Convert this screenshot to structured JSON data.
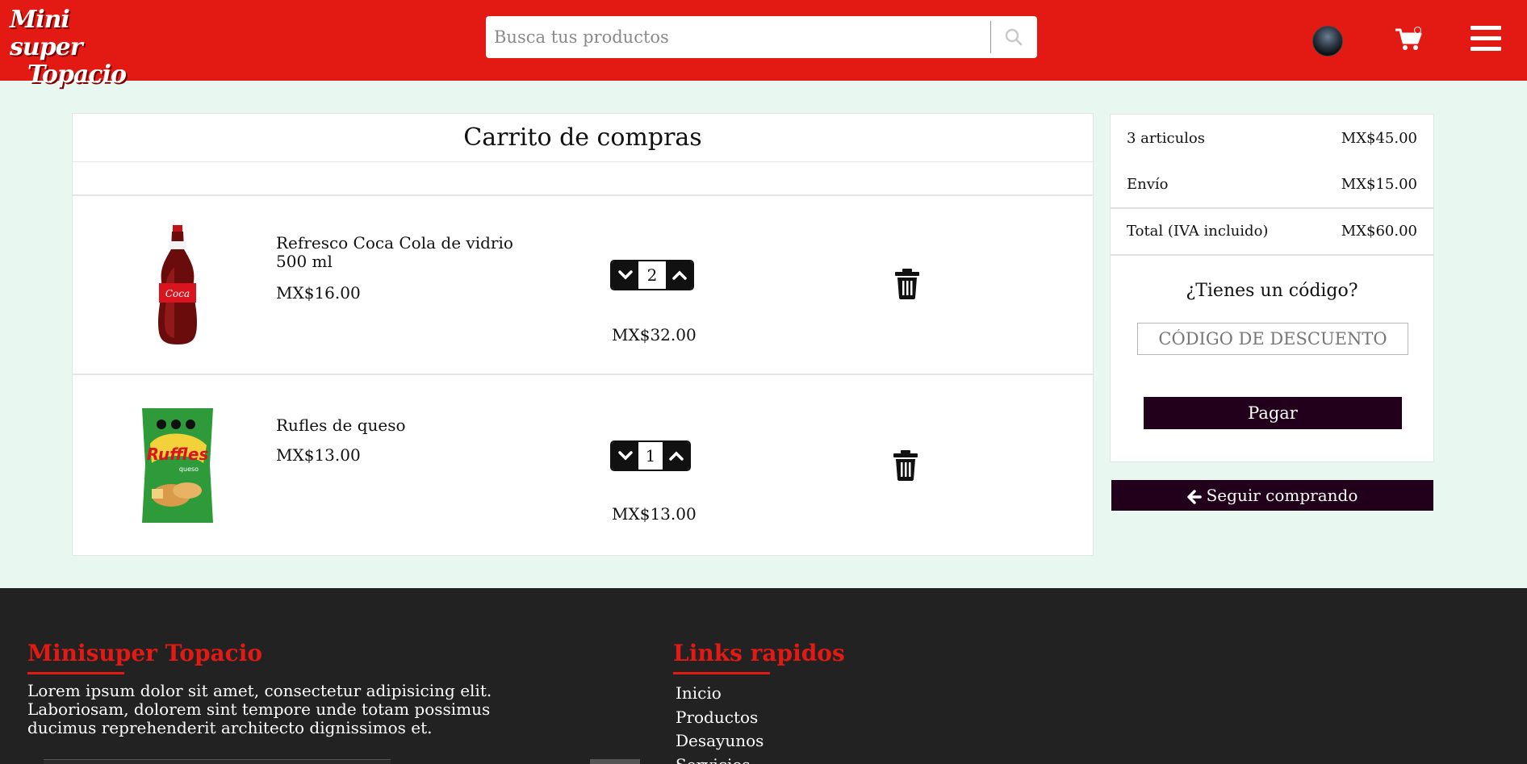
{
  "header": {
    "logo_line1": "Mini super",
    "logo_line2": "Topacio",
    "search_placeholder": "Busca tus productos",
    "cart_badge": "",
    "brand_color": "#e31a14"
  },
  "cart": {
    "title": "Carrito de compras",
    "items": [
      {
        "name": "Refresco Coca Cola de vidrio 500 ml",
        "price": "MX$16.00",
        "quantity": "2",
        "subtotal": "MX$32.00",
        "image": "coca-cola-bottle"
      },
      {
        "name": "Rufles de queso",
        "price": "MX$13.00",
        "quantity": "1",
        "subtotal": "MX$13.00",
        "image": "ruffles-queso-bag"
      }
    ]
  },
  "summary": {
    "items_label": "3 articulos",
    "items_amount": "MX$45.00",
    "shipping_label": "Envío",
    "shipping_amount": "MX$15.00",
    "total_label": "Total (IVA incluido)",
    "total_amount": "MX$60.00",
    "code_question": "¿Tienes un código?",
    "code_placeholder": "CÓDIGO DE DESCUENTO",
    "pay_label": "Pagar",
    "continue_label": "Seguir comprando",
    "button_color": "#22001b"
  },
  "footer": {
    "brand_title": "Minisuper Topacio",
    "description": "Lorem ipsum dolor sit amet, consectetur adipisicing elit. Laboriosam, dolorem sint tempore unde totam possimus ducimus reprehenderit architecto dignissimos et.",
    "links_title": "Links rapidos",
    "links": [
      "Inicio",
      "Productos",
      "Desayunos",
      "Servicios"
    ]
  }
}
